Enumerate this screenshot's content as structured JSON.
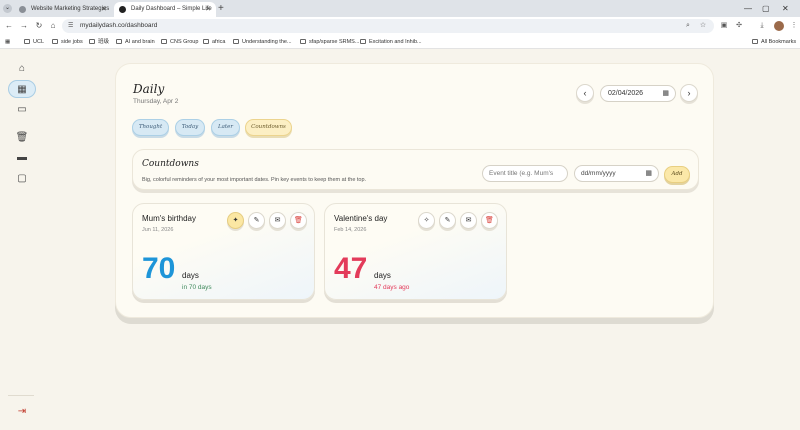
{
  "browser": {
    "tabs": [
      {
        "label": "Website Marketing Strategies"
      },
      {
        "label": "Daily Dashboard – Simple Life"
      }
    ],
    "url": "mydailydash.co/dashboard",
    "bookmarks": [
      "UCL",
      "side jobs",
      "班级",
      "AI and brain",
      "CNS Group",
      "africa",
      "Understanding the...",
      "sfap/sparse SRMS...",
      "Excitation and Inhib..."
    ],
    "all_bookmarks": "All Bookmarks"
  },
  "sidebar": {
    "icons": [
      "home-icon",
      "grid-icon",
      "book-icon",
      "trash-icon",
      "card-icon",
      "chat-icon"
    ],
    "logout_icon": "logout-icon"
  },
  "header": {
    "title": "Daily",
    "date": "Thursday, Apr 2",
    "date_value": "02/04/2026",
    "prev": "‹",
    "next": "›"
  },
  "tabs": [
    {
      "label": "Thought",
      "active": false
    },
    {
      "label": "Today",
      "active": false
    },
    {
      "label": "Later",
      "active": false
    },
    {
      "label": "Countdowns",
      "active": true
    }
  ],
  "countdowns": {
    "title": "Countdowns",
    "description": "Big, colorful reminders of your most important dates. Pin key events to keep them at the top.",
    "title_placeholder": "Event title (e.g. Mum's",
    "date_placeholder": "dd/mm/yyyy",
    "add_label": "Add"
  },
  "cards": [
    {
      "title": "Mum's birthday",
      "date": "Jun 11, 2026",
      "number": "70",
      "unit": "days",
      "relative": "in 70 days",
      "pinned": true,
      "color": "#1e95d8"
    },
    {
      "title": "Valentine's day",
      "date": "Feb 14, 2026",
      "number": "47",
      "unit": "days",
      "relative": "47 days ago",
      "pinned": false,
      "color": "#e33b5a"
    }
  ],
  "colors": {
    "accent_blue": "#1e95d8",
    "accent_red": "#e33b5a",
    "pin_yellow": "#fbe7a3"
  }
}
